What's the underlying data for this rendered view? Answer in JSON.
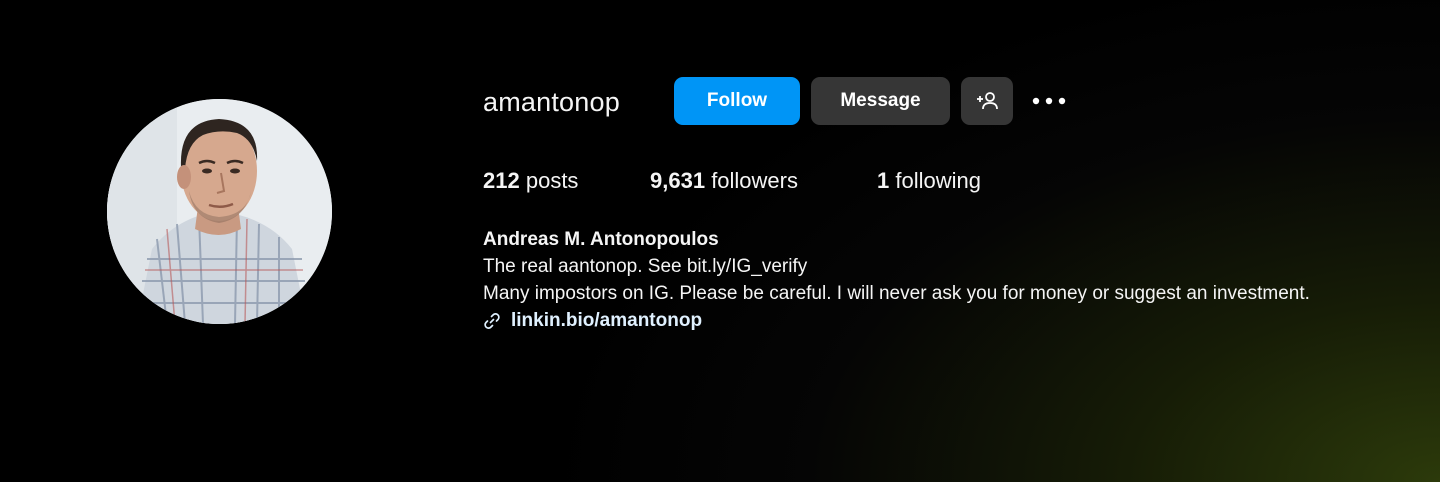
{
  "profile": {
    "username": "amantonop",
    "avatar_icon": "profile-photo",
    "follow_label": "Follow",
    "message_label": "Message",
    "suggest_icon": "add-person-icon",
    "more_icon": "more-dots-icon"
  },
  "stats": {
    "posts_count": "212",
    "posts_label": "posts",
    "followers_count": "9,631",
    "followers_label": "followers",
    "following_count": "1",
    "following_label": "following"
  },
  "bio": {
    "full_name": "Andreas M. Antonopoulos",
    "line1": "The real aantonop. See bit.ly/IG_verify",
    "line2": "Many impostors on IG. Please be careful. I will never ask you for money or suggest an investment.",
    "link": "linkin.bio/amantonop",
    "link_icon": "link-icon"
  },
  "colors": {
    "follow_button": "#0095f6",
    "secondary_button": "#363636",
    "background": "#000000",
    "link_text": "#e0f1ff"
  }
}
